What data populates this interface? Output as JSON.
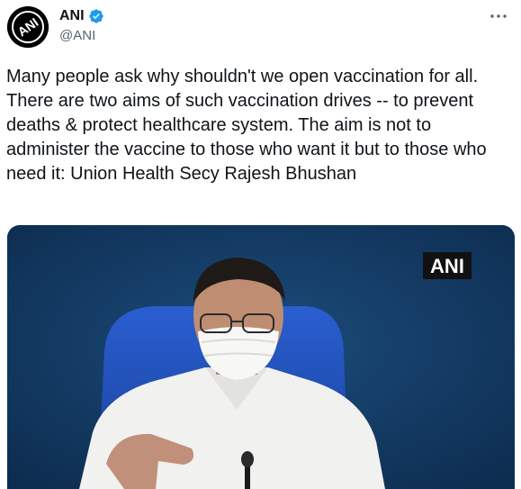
{
  "account": {
    "display_name": "ANI",
    "handle": "@ANI",
    "avatar_icon": "ani-logo-icon",
    "verified_icon": "verified-badge-icon",
    "logo_text": "ANI"
  },
  "menu": {
    "icon": "more-options-icon"
  },
  "tweet": {
    "text": "Many people ask why shouldn't we open vaccination for all. There are two aims of such vaccination drives -- to prevent deaths & protect healthcare system. The aim is not to administer the vaccine to those who want it but to those who need it: Union Health Secy Rajesh Bhushan"
  },
  "media": {
    "watermark": "ANI",
    "background_color": "#143a62",
    "chair_color": "#1f4fbf",
    "shirt_color": "#f2f2f0"
  },
  "colors": {
    "verified": "#1d9bf0",
    "secondary_text": "#536471"
  }
}
